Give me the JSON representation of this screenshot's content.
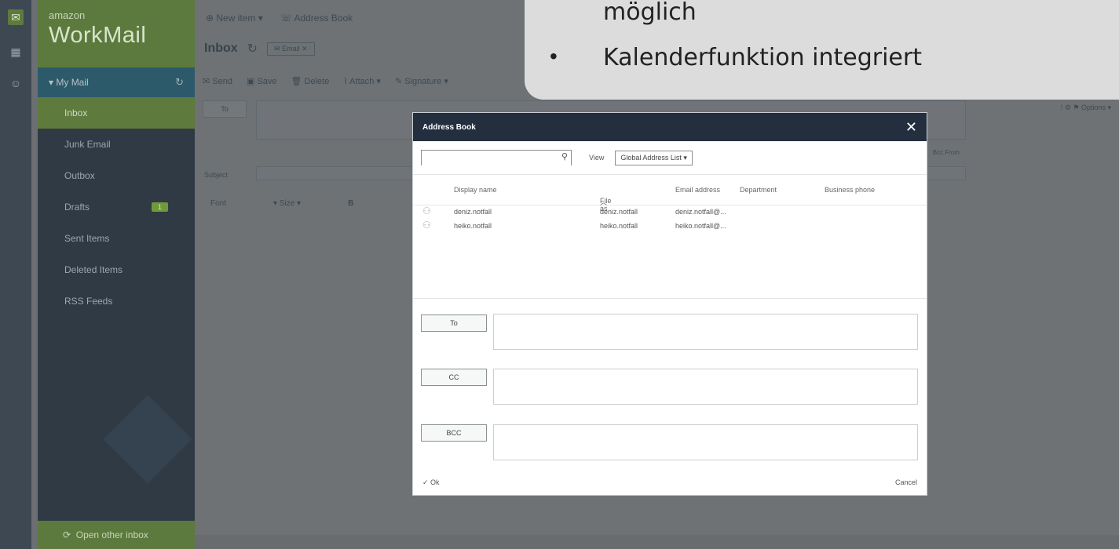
{
  "rail": {
    "icons": [
      "mail-icon",
      "calendar-icon",
      "contacts-icon"
    ]
  },
  "brand": {
    "small": "amazon",
    "big": "WorkMail"
  },
  "sidebar": {
    "section": "My Mail",
    "folders": [
      {
        "label": "Inbox",
        "count": ""
      },
      {
        "label": "Junk Email",
        "count": ""
      },
      {
        "label": "Outbox",
        "count": ""
      },
      {
        "label": "Drafts",
        "count": "1"
      },
      {
        "label": "Sent Items",
        "count": ""
      },
      {
        "label": "Deleted Items",
        "count": ""
      },
      {
        "label": "RSS Feeds",
        "count": ""
      }
    ],
    "footer": "Open other inbox"
  },
  "topbar": {
    "new_item": "New item",
    "address_book": "Address Book"
  },
  "tabs": {
    "inbox": "Inbox",
    "email_tab": "Email"
  },
  "toolbar": {
    "send": "Send",
    "save": "Save",
    "delete": "Delete",
    "attach": "Attach",
    "signature": "Signature"
  },
  "compose": {
    "to": "To",
    "subject": "Subject",
    "bcc_from": "Bcc  From",
    "options": "Options"
  },
  "format": {
    "font": "Font",
    "size": "Size",
    "bold": "B"
  },
  "dialog": {
    "title": "Address Book",
    "search_placeholder": "",
    "view_label": "View",
    "view_value": "Global Address List",
    "columns": [
      "Display name",
      "File as",
      "Email address",
      "Department",
      "Business phone"
    ],
    "entries": [
      {
        "display": "deniz.notfall",
        "file_as": "deniz.notfall",
        "email": "deniz.notfall@..."
      },
      {
        "display": "heiko.notfall",
        "file_as": "heiko.notfall",
        "email": "heiko.notfall@..."
      }
    ],
    "to": "To",
    "cc": "CC",
    "bcc": "BCC",
    "ok": "Ok",
    "cancel": "Cancel"
  },
  "slide": {
    "line1": "möglich",
    "line2": "Kalenderfunktion integriert"
  }
}
